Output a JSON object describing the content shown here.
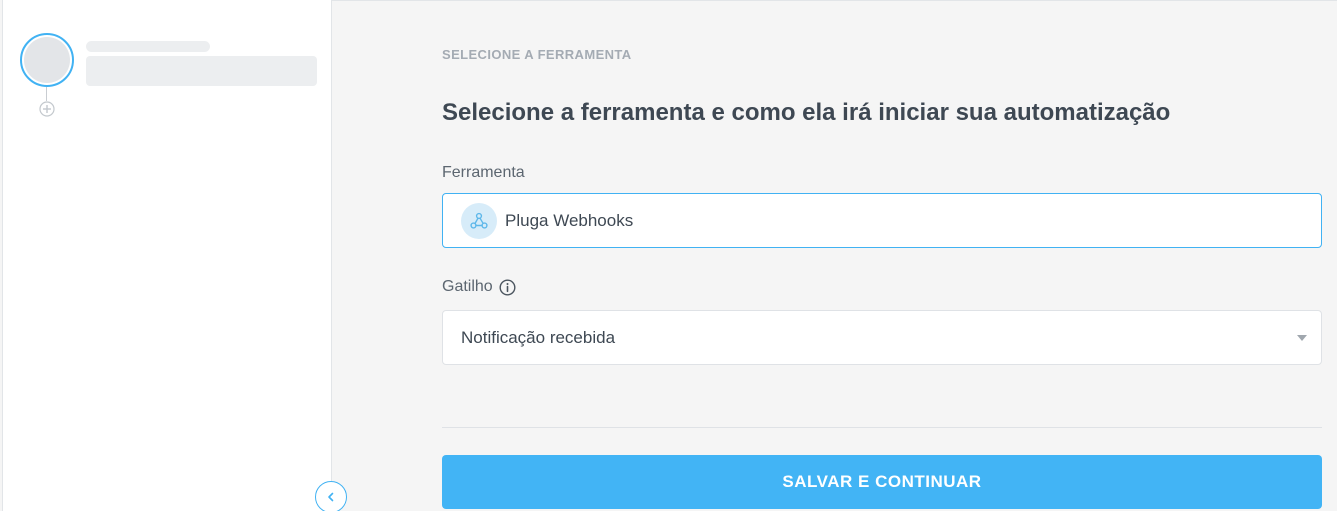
{
  "main": {
    "section_label": "SELECIONE A FERRAMENTA",
    "title": "Selecione a ferramenta e como ela irá iniciar sua automatização",
    "tool": {
      "label": "Ferramenta",
      "value": "Pluga Webhooks",
      "icon": "webhook-icon"
    },
    "trigger": {
      "label": "Gatilho",
      "value": "Notificação recebida",
      "info_icon": "info-icon"
    },
    "save_label": "SALVAR E CONTINUAR"
  },
  "colors": {
    "accent": "#41b2f3",
    "button": "#42b4f5",
    "title": "#3e4853",
    "section_label": "#a4abb3"
  }
}
